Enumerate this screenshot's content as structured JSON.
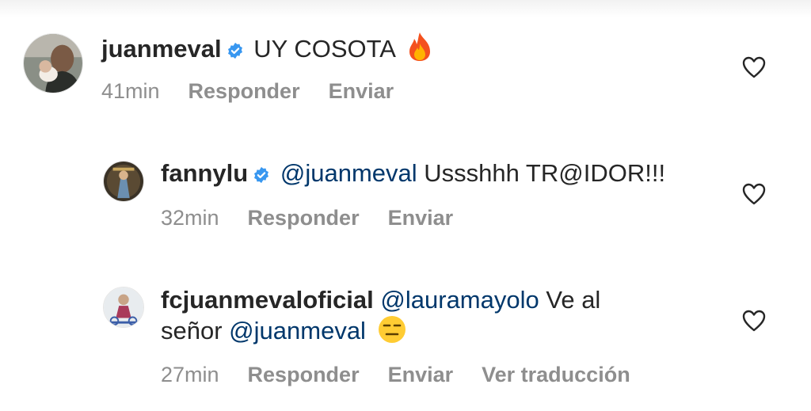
{
  "comments": [
    {
      "username": "juanmeval",
      "verified": true,
      "text": "UY COSOTA",
      "emoji": "fire-emoji",
      "time": "41min",
      "reply_label": "Responder",
      "send_label": "Enviar"
    },
    {
      "username": "fannylu",
      "verified": true,
      "mention": "@juanmeval",
      "text": "Ussshhh TR@IDOR!!!",
      "time": "32min",
      "reply_label": "Responder",
      "send_label": "Enviar"
    },
    {
      "username": "fcjuanmevaloficial",
      "verified": false,
      "mention": "@lauramayolo",
      "text_line1": "Ve al",
      "text_line2_prefix": "señor",
      "mention2": "@juanmeval",
      "emoji": "expressionless-face-emoji",
      "time": "27min",
      "reply_label": "Responder",
      "send_label": "Enviar",
      "translate_label": "Ver traducción"
    }
  ],
  "colors": {
    "primary_text": "#262626",
    "secondary_text": "#8e8e8e",
    "mention": "#00376b",
    "verified_badge": "#3897f0"
  }
}
